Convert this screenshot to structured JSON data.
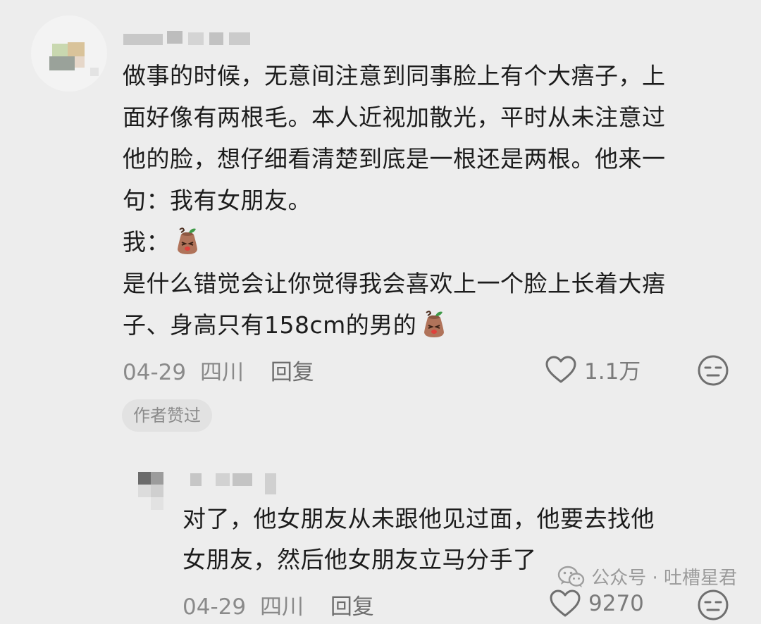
{
  "comment": {
    "lines": [
      "做事的时候，无意间注意到同事脸上有个大痦子，上",
      "面好像有两根毛。本人近视加散光，平时从未注意过",
      "他的脸，想仔细看清楚到底是一根还是两根。他来一",
      "句：我有女朋友。",
      "我：",
      "是什么错觉会让你觉得我会喜欢上一个脸上长着大痦",
      "子、身高只有158cm的男的"
    ],
    "date": "04-29",
    "location": "四川",
    "reply_label": "回复",
    "likes": "1.1万",
    "author_badge": "作者赞过"
  },
  "reply": {
    "lines": [
      "对了，他女朋友从未跟他见过面，他要去找他",
      "女朋友，然后他女朋友立马分手了"
    ],
    "date": "04-29",
    "location": "四川",
    "reply_label": "回复",
    "likes": "9270"
  },
  "watermark": {
    "text": "公众号 · 吐槽星君"
  },
  "icons": {
    "like": "heart-outline-icon",
    "dislike": "meh-face-icon",
    "emoji": "sly-bag-emoji-icon",
    "wechat": "wechat-icon"
  },
  "colors": {
    "background": "#ededed",
    "text": "#1c1c1c",
    "meta": "#8a8a8a",
    "badge_bg": "#e2e2e2"
  }
}
